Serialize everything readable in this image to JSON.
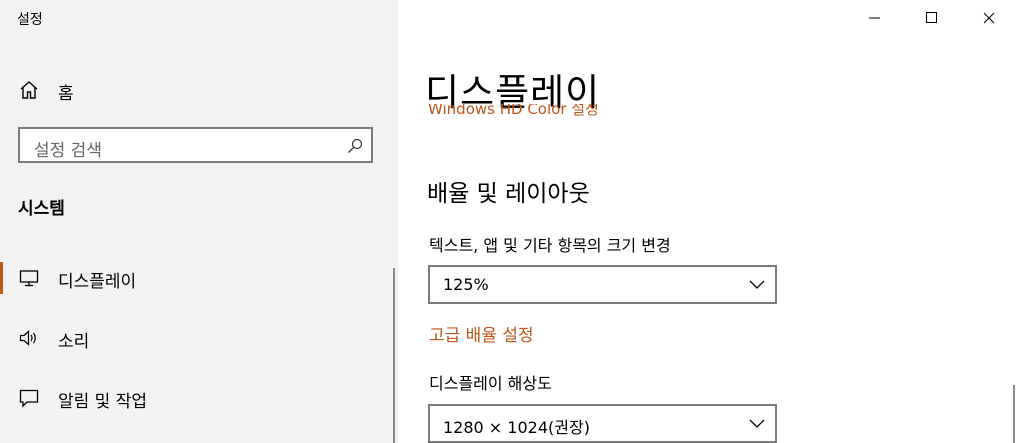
{
  "window": {
    "title": "설정",
    "controls": {
      "minimize": "minimize",
      "maximize": "maximize",
      "close": "close"
    }
  },
  "sidebar": {
    "home_label": "홈",
    "search_placeholder": "설정 검색",
    "section_heading": "시스템",
    "items": [
      {
        "label": "디스플레이",
        "icon": "monitor-icon",
        "selected": true
      },
      {
        "label": "소리",
        "icon": "speaker-icon",
        "selected": false
      },
      {
        "label": "알림 및 작업",
        "icon": "notification-icon",
        "selected": false
      }
    ]
  },
  "main": {
    "page_title": "디스플레이",
    "clipped_link": "Windows HD Color 설정",
    "scale_layout": {
      "heading": "배율 및 레이아웃",
      "text_size_label": "텍스트, 앱 및 기타 항목의 크기 변경",
      "text_size_value": "125%",
      "advanced_scaling_link": "고급 배율 설정",
      "resolution_label": "디스플레이 해상도",
      "resolution_value": "1280 × 1024(권장)"
    }
  },
  "colors": {
    "accent": "#c0561a",
    "sidebar_bg": "#f2f2f2",
    "border": "#7a7a7a"
  }
}
